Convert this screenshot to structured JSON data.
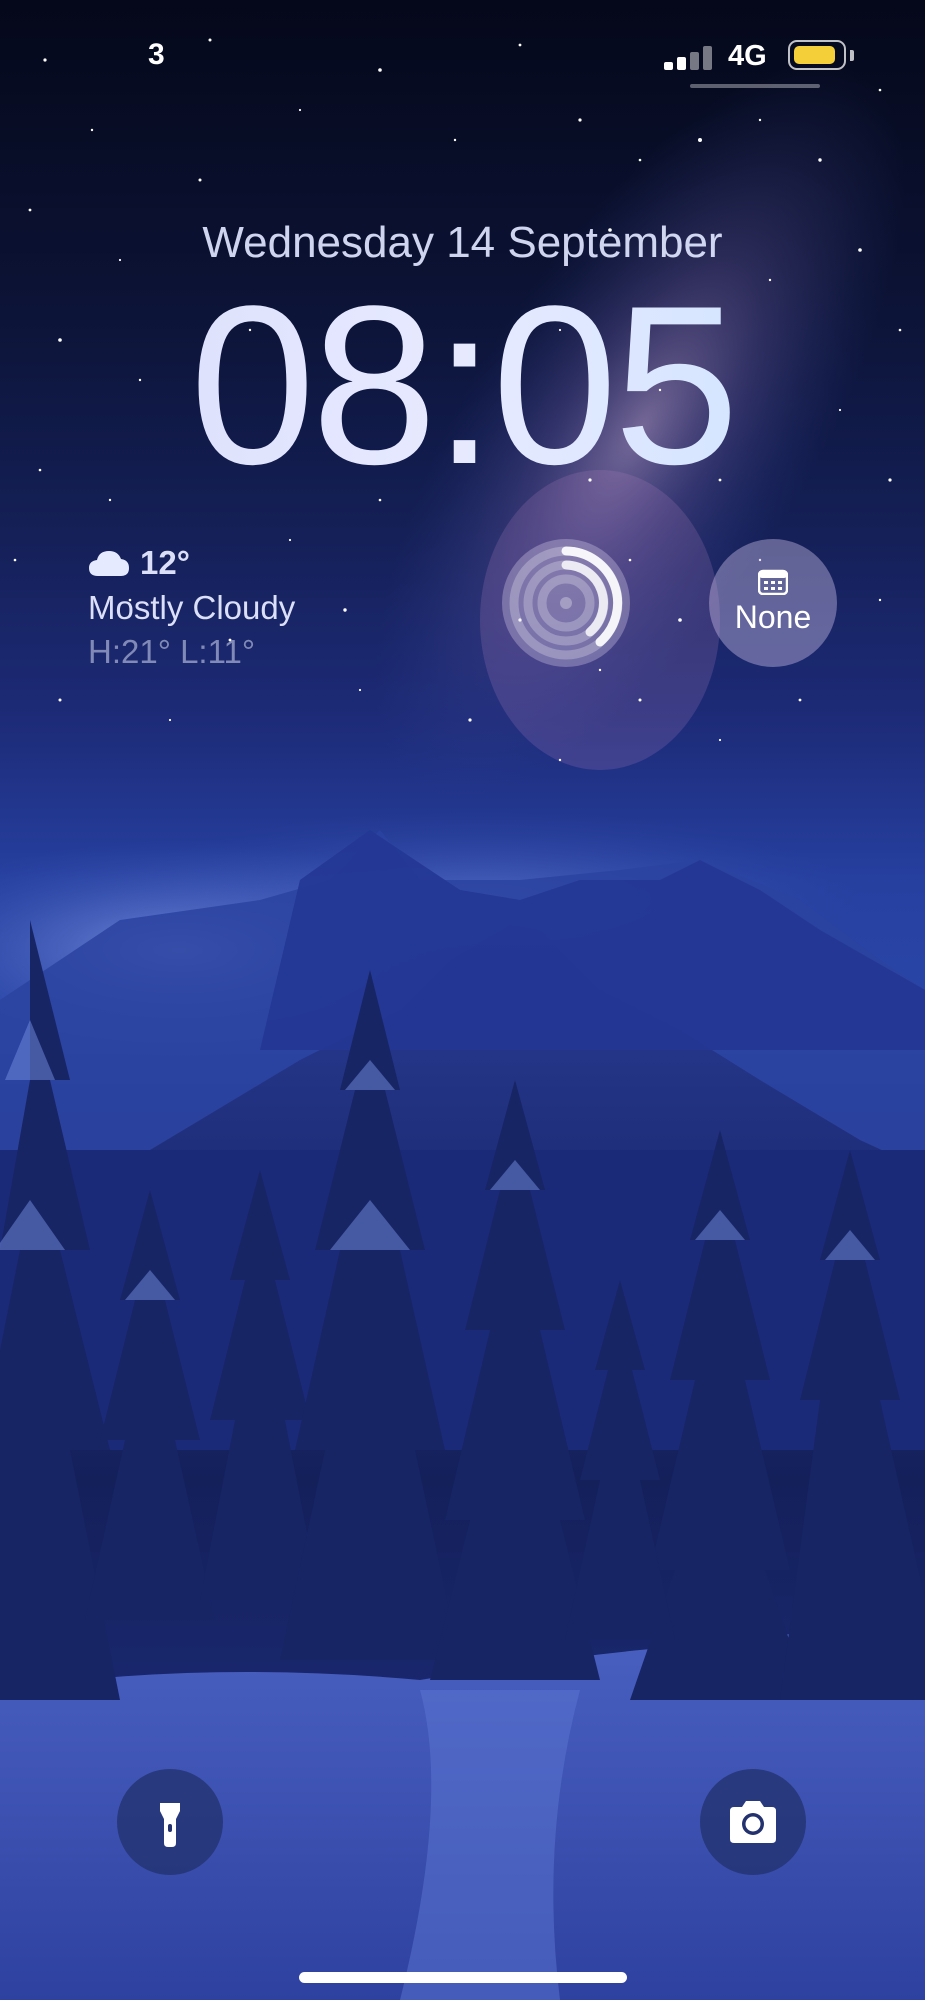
{
  "status_bar": {
    "time": "3",
    "network": "4G",
    "battery_level": 0.9,
    "battery_color": "#f5cf3a"
  },
  "lock_screen": {
    "date": "Wednesday 14 September",
    "time": "08:05"
  },
  "widgets": {
    "weather": {
      "icon": "cloud-icon",
      "temperature": "12°",
      "condition": "Mostly Cloudy",
      "high_low": "H:21° L:11°"
    },
    "activity": {
      "icon": "activity-rings-icon"
    },
    "calendar": {
      "icon": "calendar-icon",
      "label": "None"
    }
  },
  "controls": {
    "flashlight": {
      "icon": "flashlight-icon"
    },
    "camera": {
      "icon": "camera-icon"
    }
  },
  "colors": {
    "accent_text": "#dde3ff",
    "control_background": "#23326e"
  }
}
